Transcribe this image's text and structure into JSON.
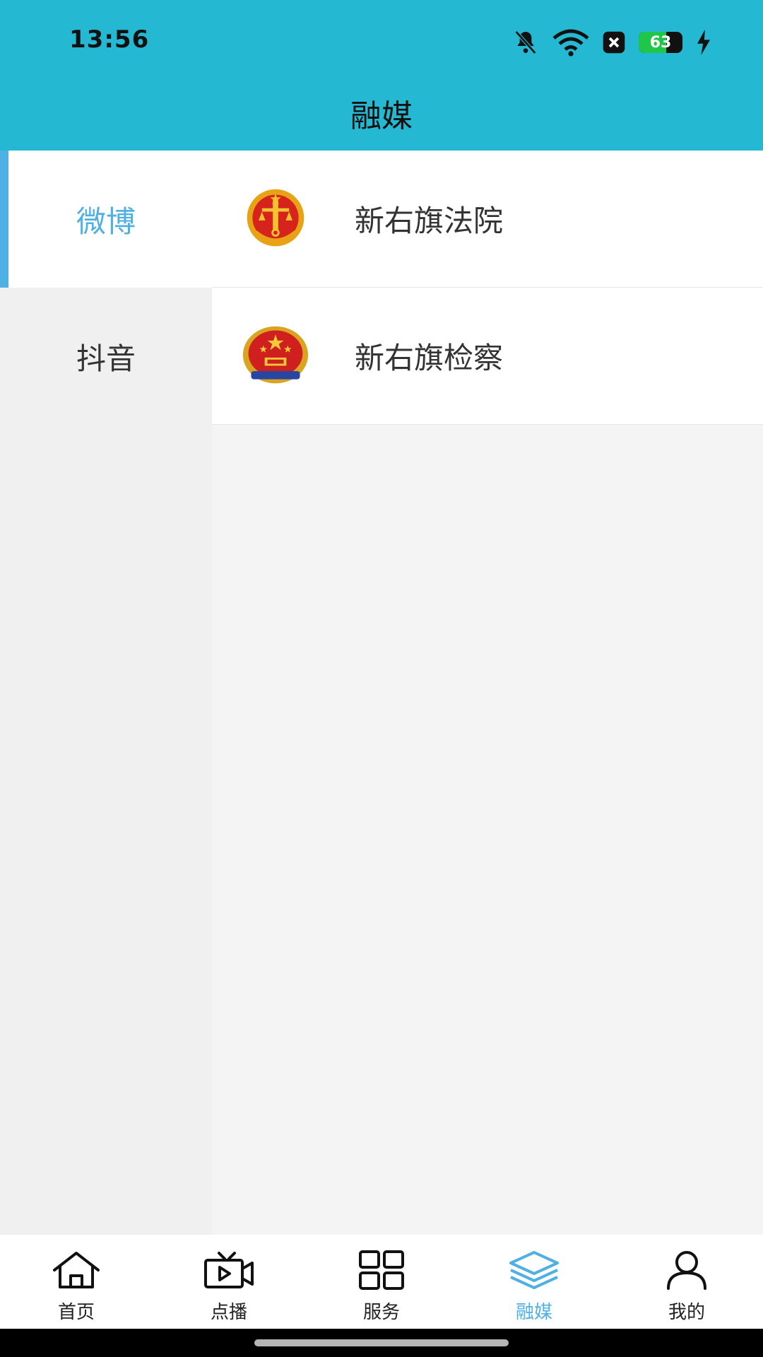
{
  "status_bar": {
    "time": "13:56",
    "battery_level": "63",
    "icons": [
      "bell-off-icon",
      "wifi-icon",
      "close-box-icon",
      "battery-icon",
      "charging-icon"
    ]
  },
  "header": {
    "title": "融媒"
  },
  "sidebar": {
    "items": [
      {
        "label": "微博",
        "active": true
      },
      {
        "label": "抖音",
        "active": false
      }
    ]
  },
  "list": {
    "items": [
      {
        "name": "新右旗法院",
        "logo": "court-emblem-icon"
      },
      {
        "name": "新右旗检察",
        "logo": "procuratorate-emblem-icon"
      }
    ]
  },
  "bottom_nav": {
    "items": [
      {
        "label": "首页",
        "icon": "home-icon",
        "active": false
      },
      {
        "label": "点播",
        "icon": "video-tv-icon",
        "active": false
      },
      {
        "label": "服务",
        "icon": "grid-icon",
        "active": false
      },
      {
        "label": "融媒",
        "icon": "layers-icon",
        "active": true
      },
      {
        "label": "我的",
        "icon": "user-icon",
        "active": false
      }
    ]
  },
  "colors": {
    "header_bg": "#25b8d3",
    "accent": "#4fb0e4",
    "sidebar_bg": "#f0f0f0",
    "content_bg": "#f4f4f4"
  }
}
